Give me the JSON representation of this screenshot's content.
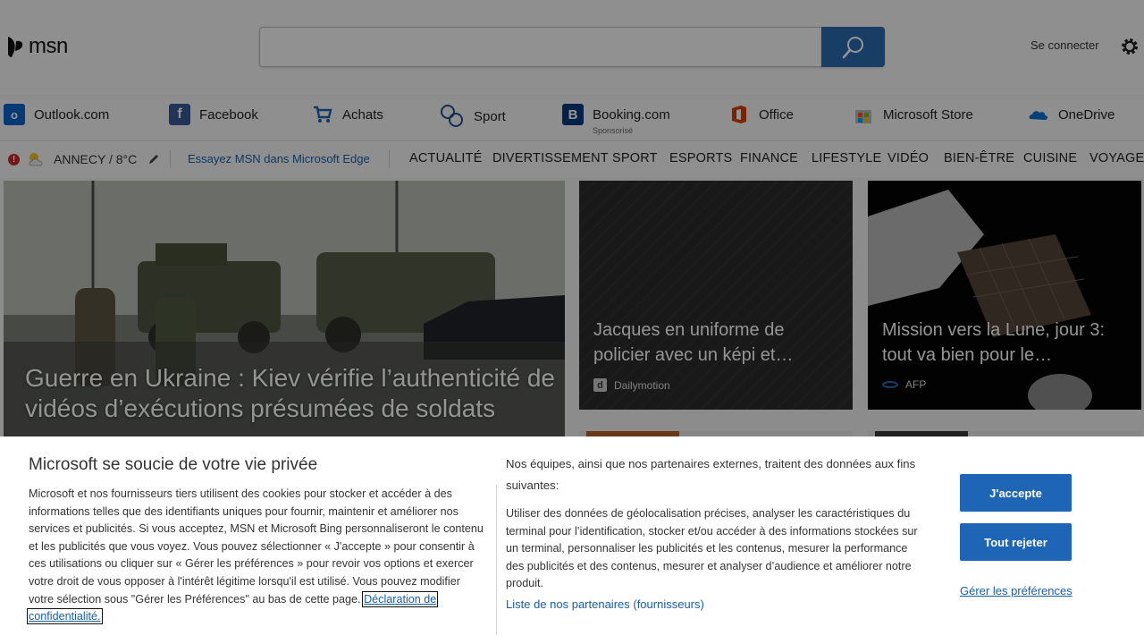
{
  "header": {
    "logo_text": "msn",
    "search_placeholder": "",
    "signin_label": "Se connecter"
  },
  "quicklinks": [
    {
      "label": "Outlook.com",
      "icon": "outlook-icon"
    },
    {
      "label": "Facebook",
      "icon": "facebook-icon"
    },
    {
      "label": "Achats",
      "icon": "cart-icon"
    },
    {
      "label": "Sport",
      "icon": "sport-icon"
    },
    {
      "label": "Booking.com",
      "icon": "booking-icon",
      "sub": "Sponsorisé"
    },
    {
      "label": "Office",
      "icon": "office-icon"
    },
    {
      "label": "Microsoft Store",
      "icon": "store-icon"
    },
    {
      "label": "OneDrive",
      "icon": "onedrive-icon"
    }
  ],
  "weather": {
    "location": "ANNECY / 8°C"
  },
  "edge_link": "Essayez MSN dans Microsoft Edge",
  "nav": [
    "ACTUALITÉ",
    "DIVERTISSEMENT",
    "SPORT",
    "ESPORTS",
    "FINANCE",
    "LIFESTYLE",
    "VIDÉO",
    "BIEN-ÊTRE",
    "CUISINE",
    "VOYAGE"
  ],
  "hero": {
    "title": "Guerre en Ukraine : Kiev vérifie l’authenticité de vidéos d’exécutions présumées de soldats"
  },
  "cards": [
    {
      "title": "Jacques en uniforme de policier avec un képi et…",
      "source": "Dailymotion",
      "source_icon": "d"
    },
    {
      "title": "Mission vers la Lune, jour 3: tout va bien pour le…",
      "source": "AFP"
    }
  ],
  "consent": {
    "title": "Microsoft se soucie de votre vie privée",
    "body": "Microsoft et nos fournisseurs tiers utilisent des cookies pour stocker et accéder à des informations telles que des identifiants uniques pour fournir, maintenir et améliorer nos services et publicités. Si vous acceptez, MSN et Microsoft Bing personnaliseront le contenu et les publicités que vous voyez. Vous pouvez sélectionner « J'accepte » pour consentir à ces utilisations ou cliquer sur « Gérer les préférences » pour revoir vos options et exercer votre droit de vous opposer à l'intérêt légitime lorsqu'il est utilisé. Vous pouvez modifier votre sélection sous \"Gérer les Préférences\" au bas de cette page.",
    "privacy_link": "Déclaration de confidentialité.",
    "purpose_head": "Nos équipes, ainsi que nos partenaires externes, traitent des données aux fins suivantes:",
    "purpose_text": "Utiliser des données de géolocalisation précises, analyser les caractéristiques du terminal pour l’identification, stocker et/ou accéder à des informations stockées sur un terminal, personnaliser les publicités et les contenus, mesurer la performance des publicités et des contenus, mesurer et analyser d’audience et améliorer notre produit.",
    "partners_link": "Liste de nos partenaires (fournisseurs)",
    "accept_label": "J'accepte",
    "reject_label": "Tout rejeter",
    "prefs_label": "Gérer les préférences"
  }
}
